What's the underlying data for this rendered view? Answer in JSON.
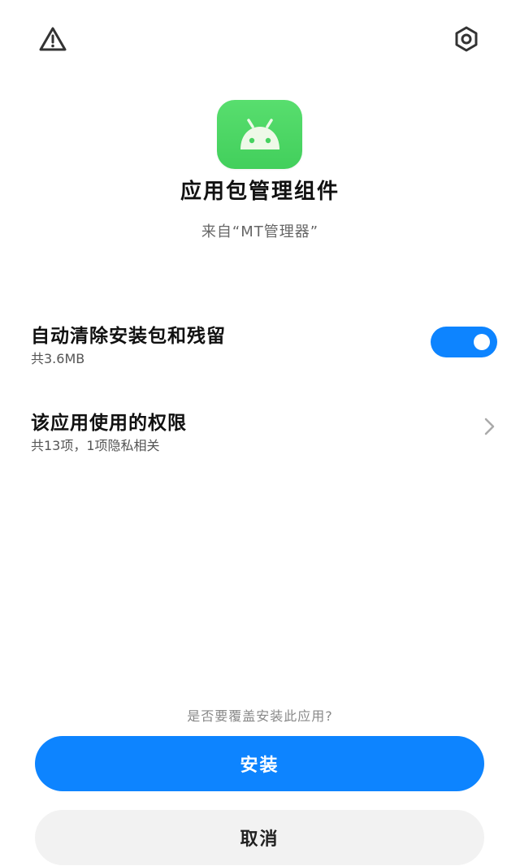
{
  "header": {
    "warning_icon": "warning-triangle-icon",
    "settings_icon": "hexagon-settings-icon"
  },
  "app": {
    "icon": "android-icon",
    "icon_color": "#4cd964",
    "name": "应用包管理组件",
    "source": "来自“MT管理器”"
  },
  "options": {
    "auto_clean": {
      "title": "自动清除安装包和残留",
      "subtitle": "共3.6MB",
      "enabled": true
    },
    "permissions": {
      "title": "该应用使用的权限",
      "subtitle": "共13项，1项隐私相关"
    }
  },
  "footer": {
    "prompt": "是否要覆盖安装此应用?",
    "install_label": "安装",
    "cancel_label": "取消"
  },
  "colors": {
    "accent": "#0d84ff",
    "cancel_bg": "#f2f2f2"
  }
}
